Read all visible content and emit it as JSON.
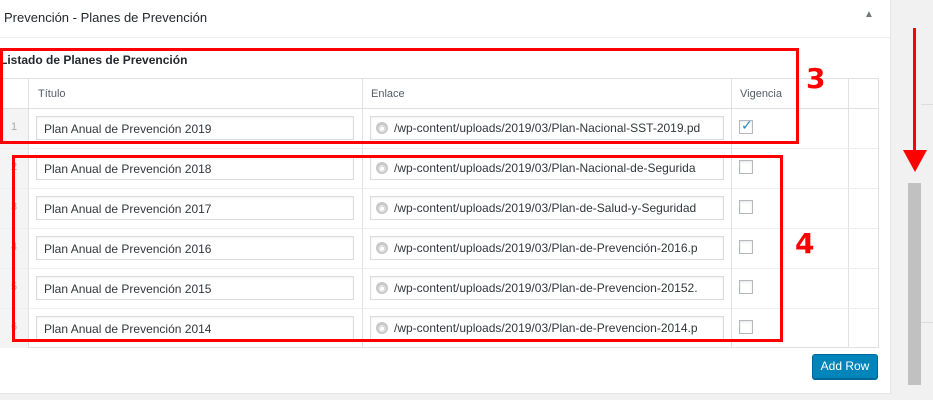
{
  "postbox": {
    "title": "Prevención - Planes de Prevención",
    "toggle_glyph": "▲"
  },
  "field": {
    "label": "Listado de Planes de Prevención"
  },
  "table": {
    "headers": {
      "title": "Título",
      "link": "Enlace",
      "vigencia": "Vigencia"
    },
    "rows": [
      {
        "order": "1",
        "title": "Plan Anual de Prevención 2019",
        "url": "/wp-content/uploads/2019/03/Plan-Nacional-SST-2019.pd",
        "vigencia": true
      },
      {
        "order": "2",
        "title": "Plan Anual de Prevención 2018",
        "url": "/wp-content/uploads/2019/03/Plan-Nacional-de-Segurida",
        "vigencia": false
      },
      {
        "order": "3",
        "title": "Plan Anual de Prevención 2017",
        "url": "/wp-content/uploads/2019/03/Plan-de-Salud-y-Seguridad",
        "vigencia": false
      },
      {
        "order": "4",
        "title": "Plan Anual de Prevención 2016",
        "url": "/wp-content/uploads/2019/03/Plan-de-Prevención-2016.p",
        "vigencia": false
      },
      {
        "order": "5",
        "title": "Plan Anual de Prevención 2015",
        "url": "/wp-content/uploads/2019/03/Plan-de-Prevencion-20152.",
        "vigencia": false
      },
      {
        "order": "6",
        "title": "Plan Anual de Prevención 2014",
        "url": "/wp-content/uploads/2019/03/Plan-de-Prevencion-2014.p",
        "vigencia": false
      }
    ],
    "check_glyph": "✓",
    "globe_glyph": "◉"
  },
  "actions": {
    "add_row_label": "Add Row"
  },
  "annotations": {
    "box_3_label": "3",
    "box_4_label": "4",
    "color": "#ff0000"
  },
  "colors": {
    "primary_button": "#0085ba",
    "checkbox_check": "#1e8cbe"
  }
}
